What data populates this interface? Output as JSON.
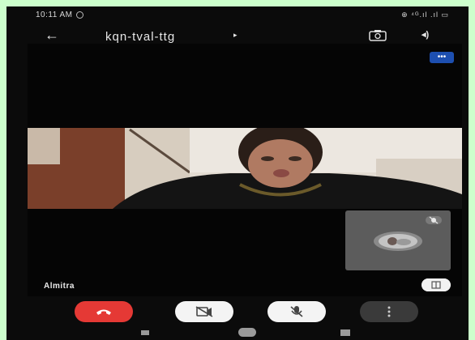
{
  "status_bar": {
    "time": "10:11 AM",
    "right": "⊕ ⁴ᴳ.ıl .ıl ▭"
  },
  "call": {
    "meeting_code": "kqn-tval-ttg",
    "title_arrow": "▸",
    "audio_label": "◂)"
  },
  "video": {
    "more_label": "•••",
    "participant_name": "Almitra"
  },
  "icons": {
    "back": "←"
  },
  "colors": {
    "end_call": "#e53935",
    "accent": "#1d4fb0"
  }
}
